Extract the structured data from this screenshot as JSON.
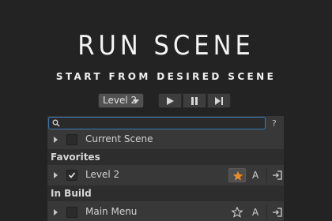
{
  "header": {
    "title": "RUN SCENE",
    "subtitle": "START FROM DESIRED SCENE"
  },
  "toolbar": {
    "level_select": "Level 2",
    "play_icon": "play-icon",
    "pause_icon": "pause-icon",
    "step_icon": "step-icon"
  },
  "search": {
    "value": "",
    "help_label": "?"
  },
  "rows": {
    "current_scene": {
      "label": "Current Scene",
      "checked": false
    },
    "favorites_header": "Favorites",
    "level2": {
      "label": "Level 2",
      "checked": true,
      "favorite": true,
      "a_label": "A"
    },
    "in_build_header": "In Build",
    "main_menu": {
      "label": "Main Menu",
      "checked": false,
      "favorite": false,
      "a_label": "A"
    }
  },
  "colors": {
    "background": "#232323",
    "panel": "#383838",
    "accent_star": "#f08a24",
    "search_border": "#3a79bb"
  }
}
